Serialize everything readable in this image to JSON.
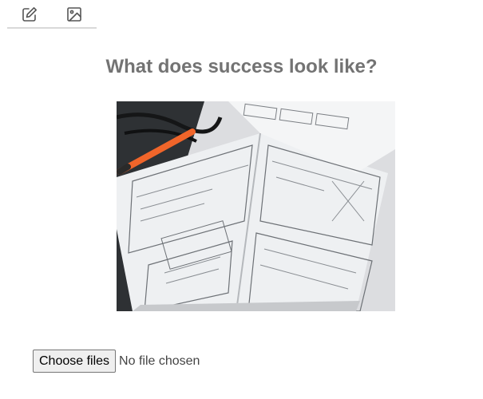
{
  "toolbar": {
    "buttons": [
      {
        "icon": "edit-icon"
      },
      {
        "icon": "image-icon"
      }
    ]
  },
  "heading": "What does success look like?",
  "photo": {
    "subject": "wireframe-sketch-notebook"
  },
  "file_input": {
    "button_label": "Choose files",
    "status_text": "No file chosen"
  },
  "colors": {
    "heading": "#737373",
    "toolbar_icon": "#555555",
    "divider": "#d9d9d9",
    "pen": "#f0652a"
  }
}
